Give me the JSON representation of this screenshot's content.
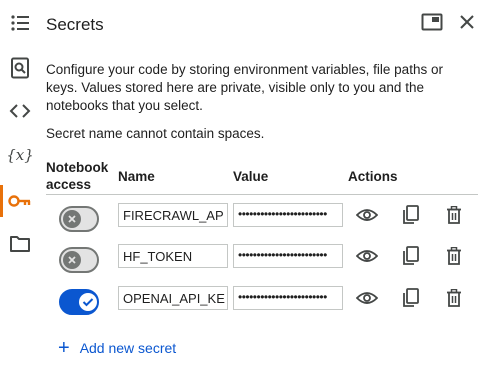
{
  "panel": {
    "title": "Secrets",
    "description": "Configure your code by storing environment variables, file paths or keys. Values stored here are private, visible only to you and the notebooks that you select.",
    "note": "Secret name cannot contain spaces."
  },
  "table": {
    "headers": {
      "access": "Notebook access",
      "name": "Name",
      "value": "Value",
      "actions": "Actions"
    },
    "rows": [
      {
        "access_enabled": false,
        "name": "FIRECRAWL_AP",
        "value": "••••••••••••••••••••••••"
      },
      {
        "access_enabled": false,
        "name": "HF_TOKEN",
        "value": "••••••••••••••••••••••••"
      },
      {
        "access_enabled": true,
        "name": "OPENAI_API_KE",
        "value": "••••••••••••••••••••••••"
      }
    ]
  },
  "add_button": {
    "label": "Add new secret"
  },
  "icons": {
    "rail": [
      "list-icon",
      "search-doc-icon",
      "code-icon",
      "variables-icon",
      "key-icon",
      "folder-icon"
    ],
    "header": [
      "open-in-tab-icon",
      "close-icon"
    ],
    "actions": [
      "eye-icon",
      "copy-icon",
      "delete-icon"
    ]
  },
  "colors": {
    "accent": "#0b57d0",
    "selected_rail": "#e8710a"
  }
}
